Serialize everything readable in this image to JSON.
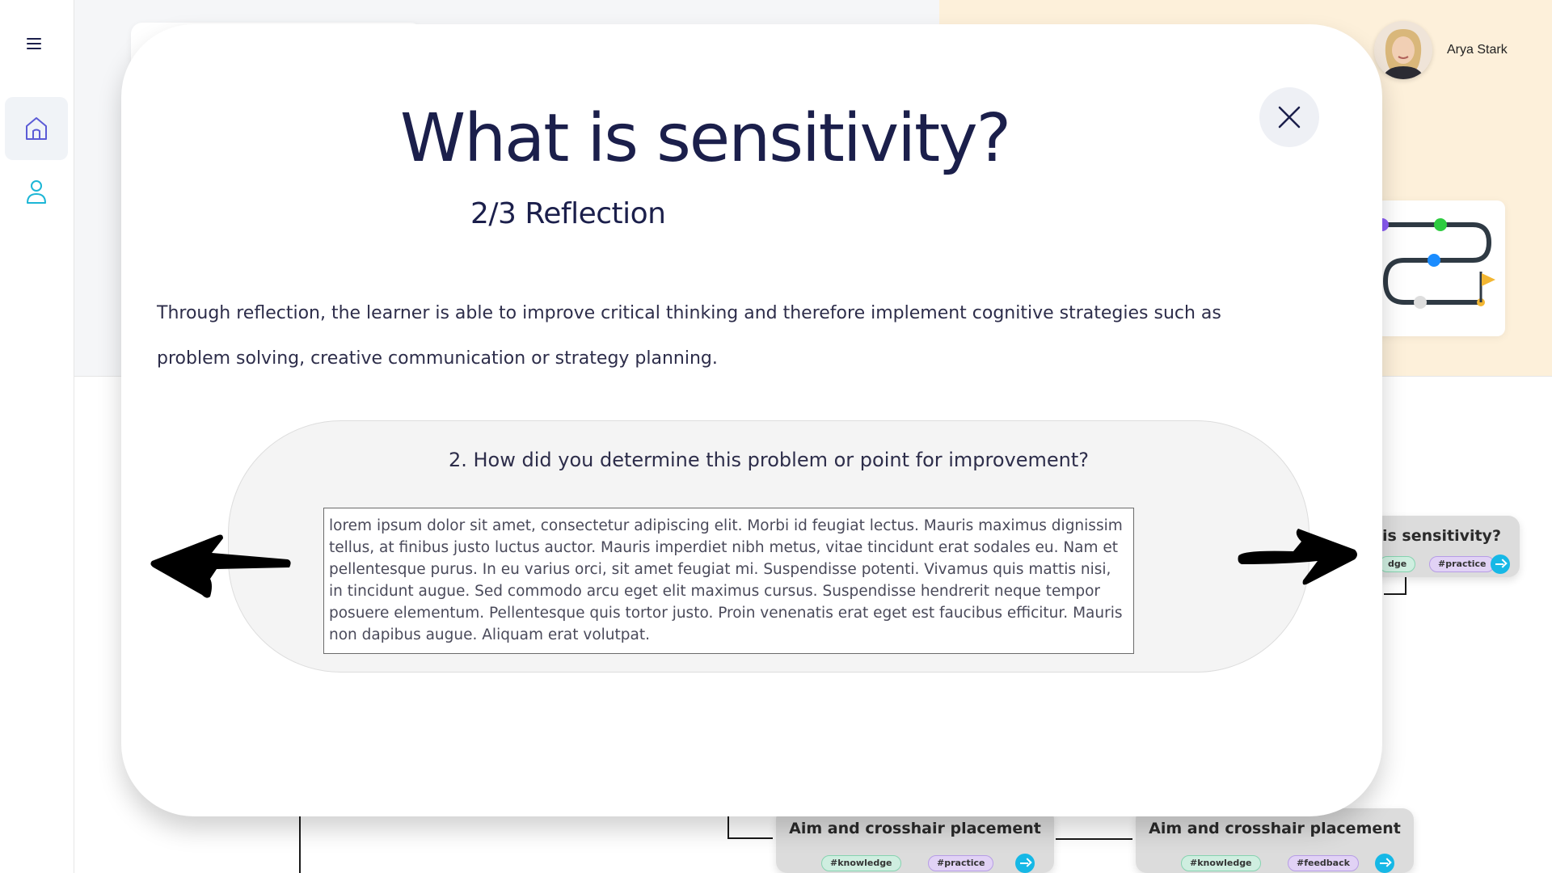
{
  "user": {
    "name": "Arya Stark"
  },
  "map": {
    "nodes": [
      {
        "title": "is sensitivity?",
        "tags": [
          "#knowledge",
          "#practice"
        ]
      },
      {
        "title": "Aim and crosshair placement",
        "tags": [
          "#knowledge",
          "#practice"
        ]
      },
      {
        "title": "Aim and crosshair placement",
        "tags": [
          "#knowledge",
          "#feedback"
        ]
      }
    ],
    "tag_partial": "dge"
  },
  "modal": {
    "title": "What is sensitivity?",
    "subtitle": "2/3 Reflection",
    "body": "Through reflection, the learner is able to improve critical thinking and therefore implement cognitive strategies such as problem solving, creative  communication or strategy planning.",
    "question": "2. How did you determine this problem or point for improvement?",
    "answer": "lorem ipsum dolor sit amet, consectetur adipiscing elit. Morbi id feugiat lectus. Mauris maximus dignissim tellus, at finibus justo luctus auctor. Mauris imperdiet nibh metus, vitae tincidunt erat sodales eu. Nam et pellentesque purus. In eu varius orci, sit amet feugiat mi. Suspendisse potenti. Vivamus quis mattis nisi, in tincidunt augue. Sed commodo arcu eget elit maximus cursus. Suspendisse hendrerit neque tempor posuere elementum. Pellentesque quis tortor justo. Proin venenatis erat eget est faucibus efficitur. Mauris non dapibus augue. Aliquam erat volutpat."
  },
  "icons": {
    "menu": "hamburger-menu-icon",
    "home": "home-icon",
    "profile": "user-icon",
    "close": "close-icon",
    "prev": "arrow-left-icon",
    "next": "arrow-right-icon"
  },
  "colors": {
    "title": "#1b1f4b",
    "accent_cyan": "#16b8e6",
    "home_icon": "#5b5bd6",
    "profile_icon": "#1cb6d6",
    "hero_peach": "#fdf0da"
  }
}
